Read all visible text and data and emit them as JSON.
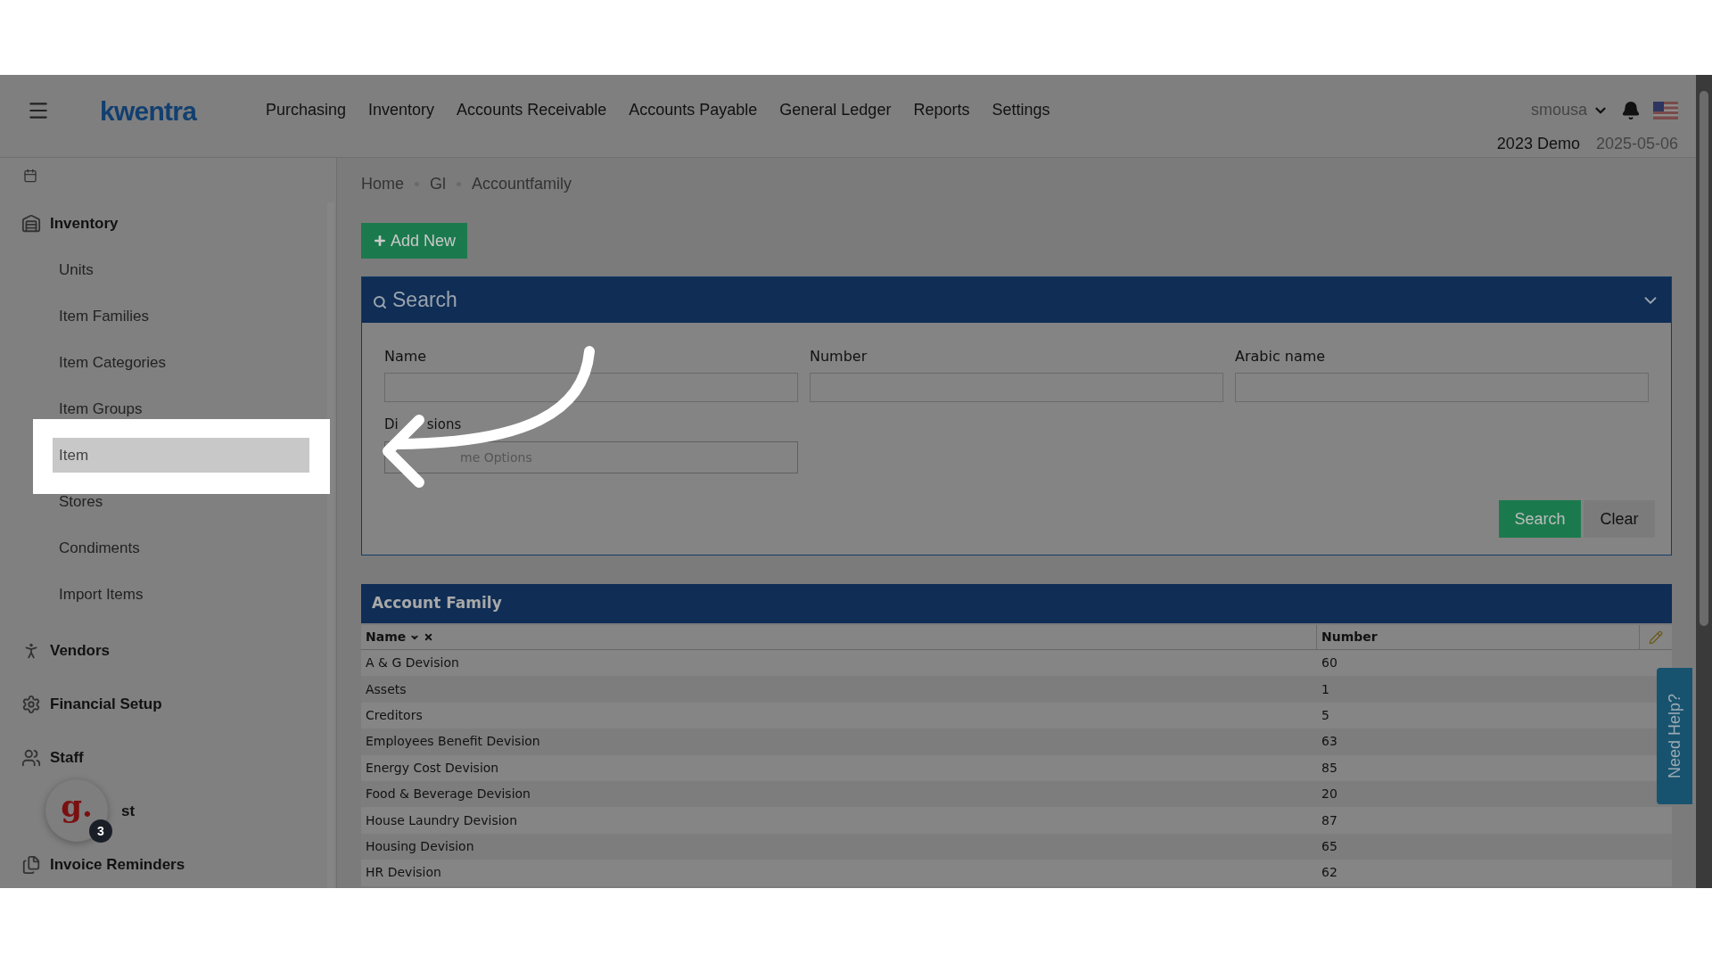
{
  "header": {
    "logo": "kwentra",
    "menu": [
      "Purchasing",
      "Inventory",
      "Accounts Receivable",
      "Accounts Payable",
      "General Ledger",
      "Reports",
      "Settings"
    ],
    "user": "smousa",
    "company": "2023 Demo",
    "date": "2025-05-06"
  },
  "sidebar": {
    "sections": [
      {
        "label": "Inventory",
        "children": [
          {
            "label": "Units",
            "selected": false
          },
          {
            "label": "Item Families",
            "selected": false
          },
          {
            "label": "Item Categories",
            "selected": false
          },
          {
            "label": "Item Groups",
            "selected": false
          },
          {
            "label": "Item",
            "selected": true
          },
          {
            "label": "Stores",
            "selected": false
          },
          {
            "label": "Condiments",
            "selected": false
          },
          {
            "label": "Import Items",
            "selected": false
          }
        ]
      },
      {
        "label": "Vendors"
      },
      {
        "label": "Financial Setup"
      },
      {
        "label": "Staff"
      },
      {
        "label": "st"
      },
      {
        "label": "Invoice Reminders"
      }
    ]
  },
  "chat_badge": {
    "logo": "g.",
    "count": "3"
  },
  "breadcrumb": [
    "Home",
    "Gl",
    "Accountfamily"
  ],
  "add_button": "Add New",
  "search_panel": {
    "title": "Search",
    "fields": [
      {
        "label": "Name",
        "kind": "text"
      },
      {
        "label": "Number",
        "kind": "text"
      },
      {
        "label": "Arabic name",
        "kind": "text"
      },
      {
        "label_parts": [
          "Di",
          "sions"
        ],
        "kind": "select",
        "placeholder": "me Options"
      }
    ],
    "buttons": [
      "Search",
      "Clear"
    ]
  },
  "table": {
    "title": "Account Family",
    "columns": [
      "Name",
      "Number"
    ],
    "rows": [
      [
        "A & G Devision",
        "60"
      ],
      [
        "Assets",
        "1"
      ],
      [
        "Creditors",
        "5"
      ],
      [
        "Employees Benefit Devision",
        "63"
      ],
      [
        "Energy Cost Devision",
        "85"
      ],
      [
        "Food & Beverage Devision",
        "20"
      ],
      [
        "House Laundry Devision",
        "87"
      ],
      [
        "Housing Devision",
        "65"
      ],
      [
        "HR Devision",
        "62"
      ]
    ]
  },
  "help_tab": "Need Help?"
}
